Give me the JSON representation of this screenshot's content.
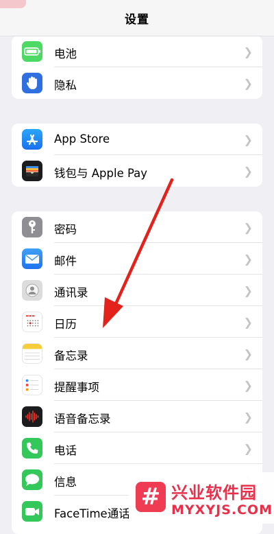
{
  "header": {
    "title": "设置"
  },
  "groups": [
    {
      "items": [
        {
          "label": "电池",
          "icon": "battery-icon",
          "color": "#4cd964"
        },
        {
          "label": "隐私",
          "icon": "hand-icon",
          "color": "#2f6fe0"
        }
      ]
    },
    {
      "items": [
        {
          "label": "App Store",
          "icon": "app-store-icon",
          "color": "#1b8cf6"
        },
        {
          "label": "钱包与 Apple Pay",
          "icon": "wallet-icon",
          "color": "#1c1c1e"
        }
      ]
    },
    {
      "items": [
        {
          "label": "密码",
          "icon": "key-icon",
          "color": "#8e8e93"
        },
        {
          "label": "邮件",
          "icon": "mail-icon",
          "color": "#2e8cf7"
        },
        {
          "label": "通讯录",
          "icon": "contacts-icon",
          "color": "#d9d9d9"
        },
        {
          "label": "日历",
          "icon": "calendar-icon",
          "color": "#ffffff"
        },
        {
          "label": "备忘录",
          "icon": "notes-icon",
          "color": "#ffffff"
        },
        {
          "label": "提醒事项",
          "icon": "reminders-icon",
          "color": "#ffffff"
        },
        {
          "label": "语音备忘录",
          "icon": "voice-memos-icon",
          "color": "#1c1c1e"
        },
        {
          "label": "电话",
          "icon": "phone-icon",
          "color": "#34c759"
        },
        {
          "label": "信息",
          "icon": "messages-icon",
          "color": "#34c759"
        },
        {
          "label": "FaceTime通话",
          "icon": "facetime-icon",
          "color": "#34c759"
        }
      ]
    }
  ],
  "watermark": {
    "name": "兴业软件园",
    "site": "MYXYJS.COM",
    "logo_glyph": "#"
  },
  "annotation": {
    "color": "#e3221b",
    "icon": "red-arrow-icon"
  }
}
